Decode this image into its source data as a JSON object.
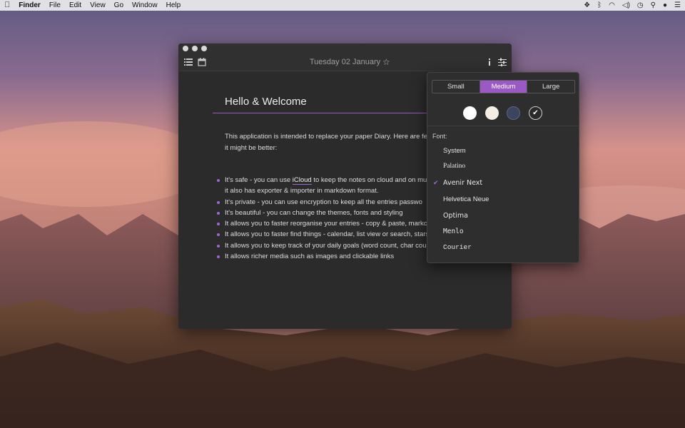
{
  "menubar": {
    "apple": "",
    "app": "Finder",
    "items": [
      "File",
      "Edit",
      "View",
      "Go",
      "Window",
      "Help"
    ]
  },
  "window": {
    "date": "Tuesday 02 January",
    "icons": [
      "list-icon",
      "calendar-icon",
      "star-icon",
      "info-icon",
      "sliders-icon"
    ]
  },
  "document": {
    "heading": "Hello & Welcome",
    "intro_line1": "This application is intended to replace your paper Diary. Here are fe",
    "intro_line2": "it might be better:",
    "bullets": [
      {
        "pre": "It's safe - you can use ",
        "link": "iCloud",
        "post": " to keep the notes on cloud and on mu"
      },
      {
        "pre": "it also has exporter & importer in markdown format.",
        "link": "",
        "post": "",
        "nodot": true
      },
      {
        "pre": "It's private - you can use encryption to keep all the entries passwo",
        "link": "",
        "post": ""
      },
      {
        "pre": "It's beautiful - you can change the themes, fonts  and styling",
        "link": "",
        "post": ""
      },
      {
        "pre": "It allows you to faster reorganise your entries - copy & paste, markc",
        "link": "",
        "post": ""
      },
      {
        "pre": "It allows you to faster find things - calendar, list view or search, stars",
        "link": "",
        "post": ""
      },
      {
        "pre": "It allows you to keep track of your daily goals (word count, char cou",
        "link": "",
        "post": ""
      },
      {
        "pre": "It allows richer media such as images and clickable links",
        "link": "",
        "post": ""
      }
    ]
  },
  "settings": {
    "sizes": [
      "Small",
      "Medium",
      "Large"
    ],
    "selected_size": "Medium",
    "themes": [
      "#ffffff",
      "#f3ede4",
      "#3b4560",
      "#2b2b2b"
    ],
    "font_label": "Font:",
    "fonts": [
      "System",
      "Palatino",
      "Avenir Next",
      "Helvetica Neue",
      "Optima",
      "Menlo",
      "Courier"
    ],
    "selected_font": "Avenir Next",
    "accent": "#9b59c6"
  }
}
